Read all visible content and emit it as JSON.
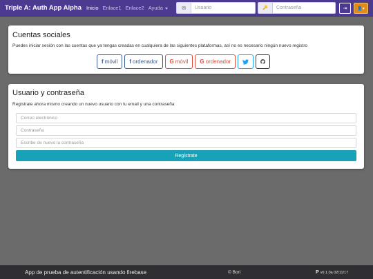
{
  "navbar": {
    "brand": "Triple A: Auth App Alpha",
    "links": [
      {
        "label": "Inicio"
      },
      {
        "label": "Enlace1"
      },
      {
        "label": "Enlace2"
      },
      {
        "label": "Ayuda"
      }
    ],
    "username_placeholder": "Usuario",
    "password_placeholder": "Contraseña",
    "email_icon": "✉",
    "key_icon": "🔑",
    "login_icon": "⇥",
    "user_icon": "👤▾",
    "colors": {
      "bar": "#4b3a8f",
      "user_button": "#e08a17"
    }
  },
  "social": {
    "title": "Cuentas sociales",
    "text": "Puedes iniciar sesión con las cuentas que ya tengas creadas en cualquiera de las siguientes plataformas, así no es necesario ningún nuevo registro",
    "buttons": [
      {
        "icon": "f",
        "label": "móvil"
      },
      {
        "icon": "f",
        "label": "ordenador"
      },
      {
        "icon": "G",
        "label": "móvil"
      },
      {
        "icon": "G",
        "label": "ordenador"
      },
      {
        "icon": "twitter-icon",
        "label": ""
      },
      {
        "icon": "github-icon",
        "label": ""
      }
    ]
  },
  "register": {
    "title": "Usuario y contraseña",
    "text": "Registrate ahora mismo creando un nuevo usuario con tu email y una contraseña",
    "email_placeholder": "Correo electrónico",
    "password_placeholder": "Contraseña",
    "repeat_placeholder": "Escribe de nuevo la contraseña",
    "submit_label": "Regístrate",
    "accent": "#17a2b8"
  },
  "footer": {
    "description": "App de prueba de autentificación usando firebase",
    "copyright": "© Bori",
    "version_icon": "P",
    "version": "v0.1.0a 02/11/17"
  }
}
